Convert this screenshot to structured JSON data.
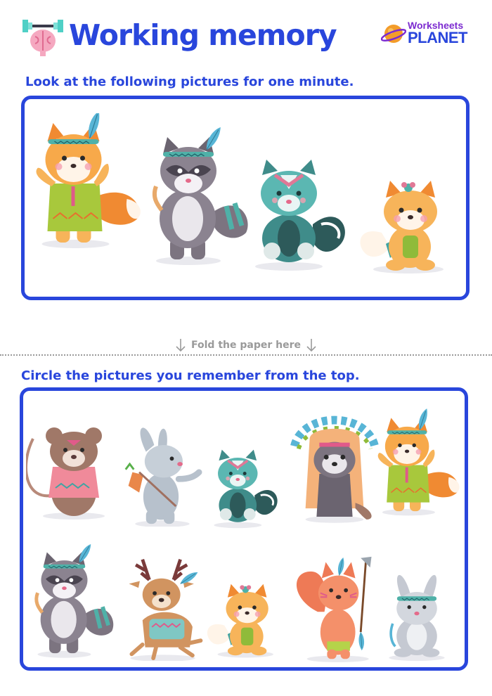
{
  "header": {
    "title": "Working memory",
    "icon": "brain-dumbbell-icon",
    "logo": {
      "line1": "Worksheets",
      "line2": "PLANET"
    }
  },
  "section_top": {
    "instruction": "Look at the following pictures for one minute.",
    "animals": [
      "fox",
      "raccoon",
      "skunk",
      "fox-cub"
    ]
  },
  "fold": {
    "label": "Fold the paper here",
    "icon": "arrow-down-icon"
  },
  "section_bottom": {
    "instruction": "Circle the pictures you remember from the top.",
    "row1": [
      "mouse",
      "rabbit",
      "skunk",
      "owl",
      "fox"
    ],
    "row2": [
      "raccoon",
      "deer",
      "fox-cub",
      "squirrel",
      "bunny"
    ]
  },
  "colors": {
    "accent": "#2946dc",
    "fold_gray": "#9a9a9a",
    "orange": "#f29b38",
    "gray_animal": "#7c7480",
    "teal": "#3fa4a3"
  }
}
